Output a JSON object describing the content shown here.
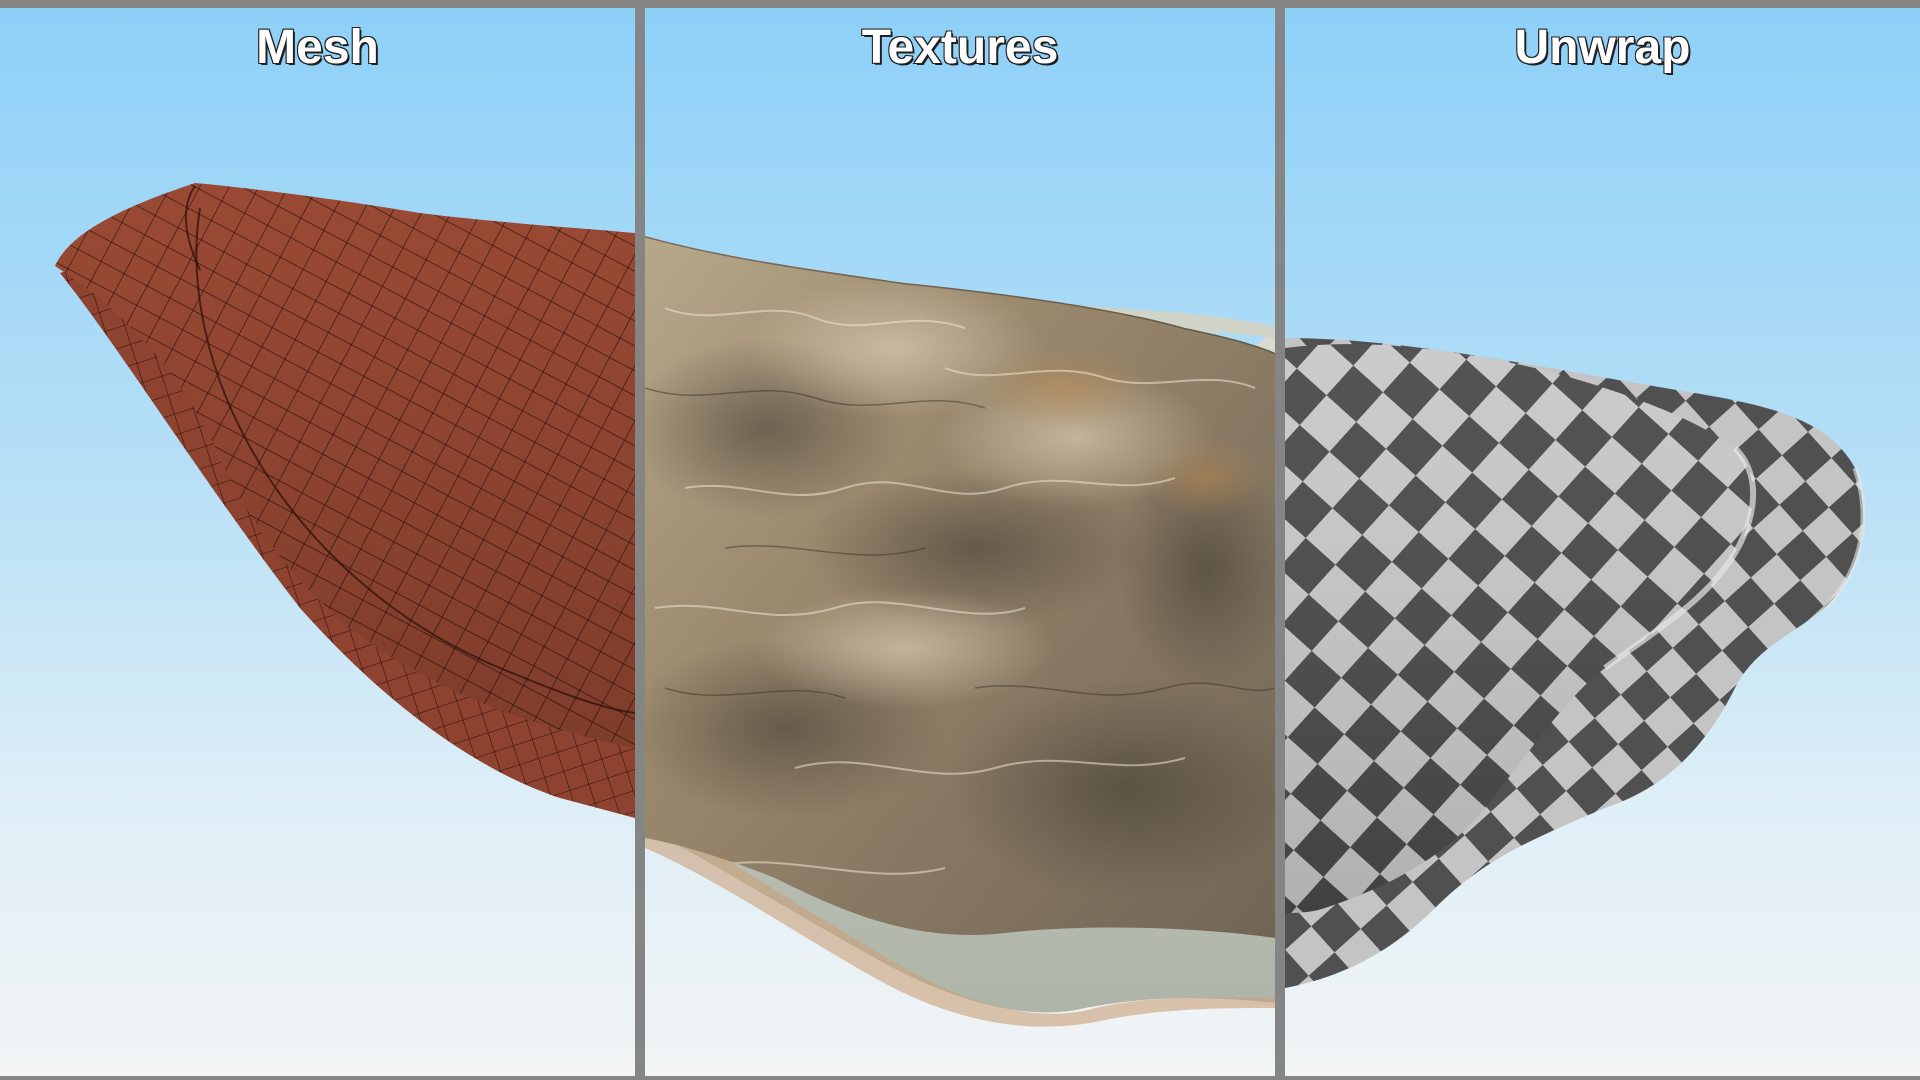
{
  "panels": [
    {
      "title": "Mesh",
      "view": "wireframe-mesh",
      "color": "#9a4a34"
    },
    {
      "title": "Textures",
      "view": "textured-stone",
      "color": "#a8937a"
    },
    {
      "title": "Unwrap",
      "view": "uv-checker",
      "color": "#4a4a4a"
    }
  ],
  "colors": {
    "divider": "#858585",
    "sky_top": "#8ed0f8",
    "sky_bottom": "#f2f4f5",
    "mesh_fill": "#9a4a34",
    "mesh_line": "#2a1008",
    "checker_dark": "#4a4a4a",
    "checker_light": "#c8c8c8"
  }
}
